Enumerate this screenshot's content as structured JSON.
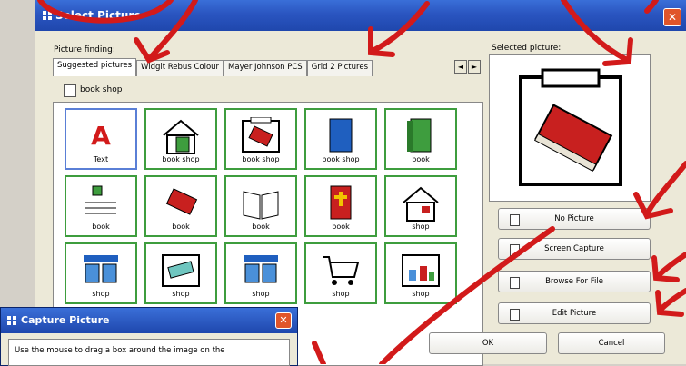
{
  "main_window": {
    "title": "Select Picture",
    "close_label": "✕",
    "picture_finding_label": "Picture finding:",
    "selected_picture_label": "Selected picture:",
    "tabs": [
      {
        "label": "Suggested pictures",
        "active": true
      },
      {
        "label": "Widgit Rebus Colour",
        "active": false
      },
      {
        "label": "Mayer Johnson PCS",
        "active": false
      },
      {
        "label": "Grid 2 Pictures",
        "active": false
      }
    ],
    "tab_scroll_left": "◄",
    "tab_scroll_right": "►",
    "search_text": "book shop",
    "pictures": [
      {
        "label": "Text",
        "icon": "letter-a-icon"
      },
      {
        "label": "book shop",
        "icon": "house-book-icon"
      },
      {
        "label": "book shop",
        "icon": "book-shop-sign-icon"
      },
      {
        "label": "book shop",
        "icon": "blue-book-icon"
      },
      {
        "label": "book",
        "icon": "green-book-icon"
      },
      {
        "label": "book",
        "icon": "book-list-icon"
      },
      {
        "label": "book",
        "icon": "red-book-icon"
      },
      {
        "label": "book",
        "icon": "open-book-icon"
      },
      {
        "label": "book",
        "icon": "bible-icon"
      },
      {
        "label": "shop",
        "icon": "house-shop-icon"
      },
      {
        "label": "shop",
        "icon": "shopfront-icon"
      },
      {
        "label": "shop",
        "icon": "shop-sign-icon"
      },
      {
        "label": "shop",
        "icon": "shopfront-icon"
      },
      {
        "label": "shop",
        "icon": "shopping-cart-icon"
      },
      {
        "label": "shop",
        "icon": "shop-display-icon"
      }
    ],
    "buttons": {
      "no_picture": "No Picture",
      "screen_capture": "Screen Capture",
      "browse_for_file": "Browse For File",
      "edit_picture": "Edit Picture",
      "ok": "OK",
      "cancel": "Cancel"
    }
  },
  "capture_window": {
    "title": "Capture Picture",
    "close_label": "✕",
    "instruction": "Use the mouse to drag a box around the image on the"
  },
  "colors": {
    "title_blue": "#2a55c0",
    "cell_border": "#3e9d3e",
    "annotation_red": "#d21a1a",
    "book_red": "#c8201f"
  }
}
